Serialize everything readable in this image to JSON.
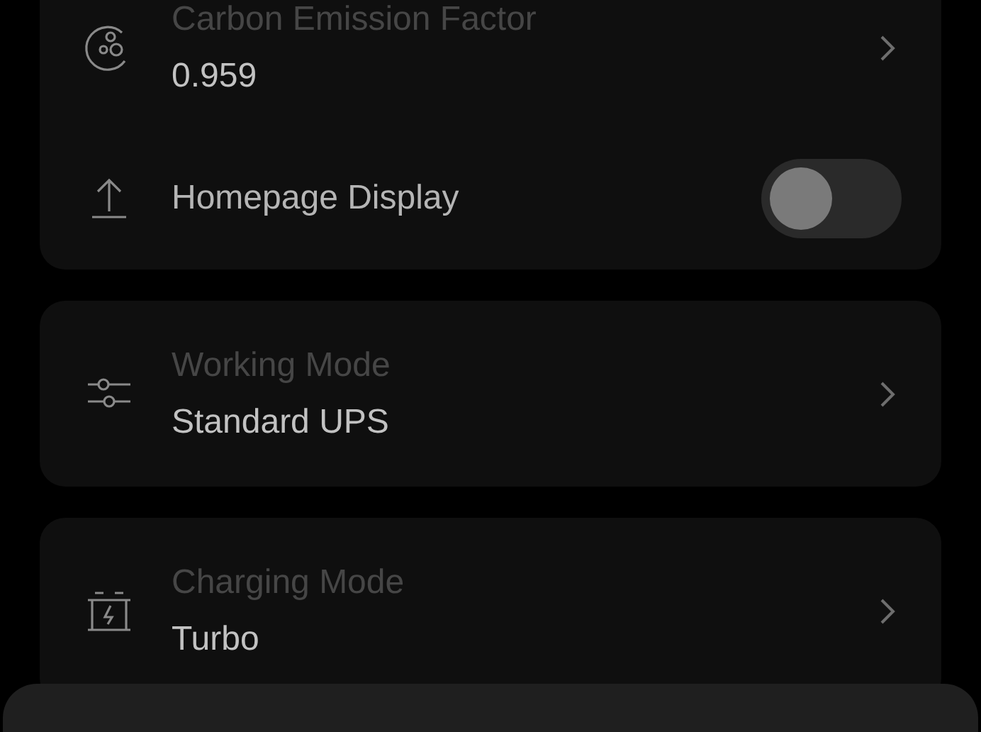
{
  "cards": [
    {
      "rows": [
        {
          "kind": "value",
          "title": "Carbon Emission Factor",
          "value": "0.959"
        },
        {
          "kind": "toggle",
          "label": "Homepage Display",
          "on": false
        }
      ]
    },
    {
      "rows": [
        {
          "kind": "value",
          "title": "Working Mode",
          "value": "Standard UPS"
        }
      ]
    },
    {
      "rows": [
        {
          "kind": "value",
          "title": "Charging Mode",
          "value": "Turbo"
        }
      ]
    }
  ]
}
